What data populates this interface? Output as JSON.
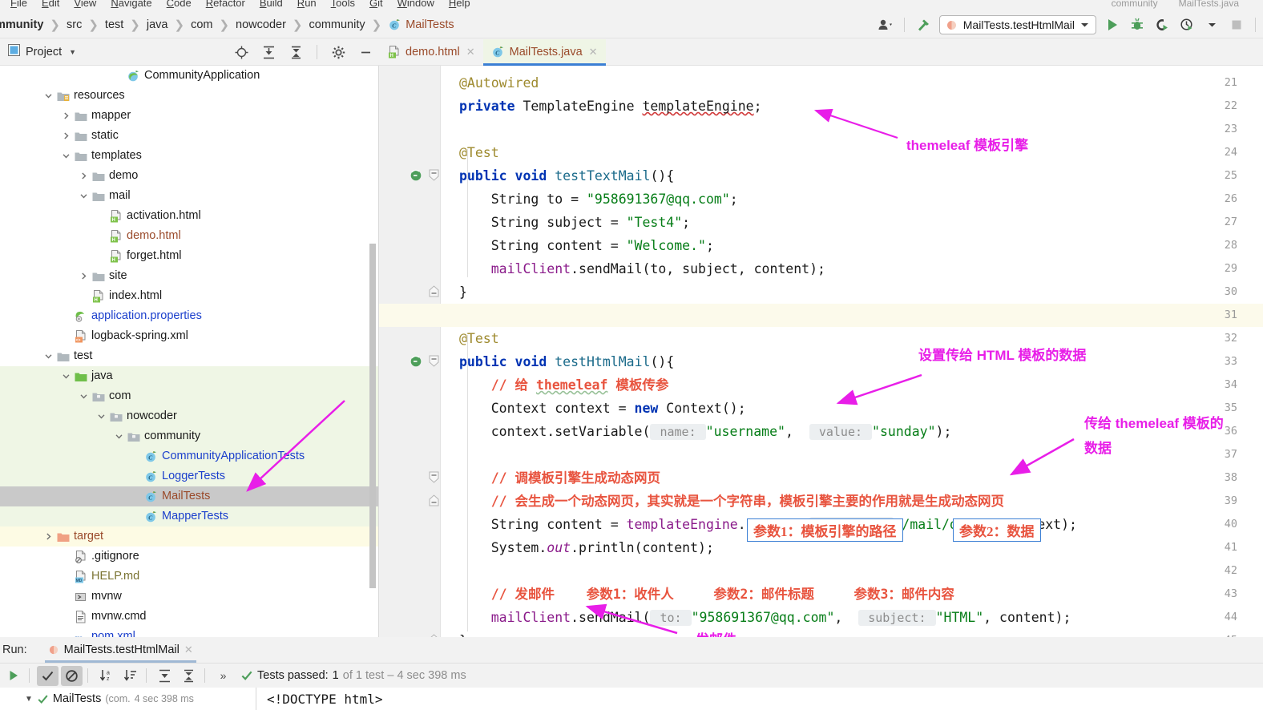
{
  "menu": {
    "items": [
      "File",
      "Edit",
      "View",
      "Navigate",
      "Code",
      "Refactor",
      "Build",
      "Run",
      "Tools",
      "Git",
      "Window",
      "Help"
    ],
    "right_hints": [
      "community",
      "MailTests.java"
    ]
  },
  "navbar": {
    "breadcrumbs": [
      {
        "label": "mmunity",
        "style": "bold"
      },
      {
        "label": "src",
        "style": "plain"
      },
      {
        "label": "test",
        "style": "plain"
      },
      {
        "label": "java",
        "style": "plain"
      },
      {
        "label": "com",
        "style": "plain"
      },
      {
        "label": "nowcoder",
        "style": "plain"
      },
      {
        "label": "community",
        "style": "plain"
      },
      {
        "label": "MailTests",
        "style": "class"
      }
    ],
    "separator": "❯",
    "run_config": "MailTests.testHtmlMail",
    "icons": [
      "user-icon",
      "hammer-icon",
      "run-icon",
      "debug-icon",
      "run-coverage-icon",
      "profile-icon",
      "stop-icon"
    ]
  },
  "project_panel": {
    "title": "Project",
    "toolbar_icons": [
      "locate-icon",
      "expand-all-icon",
      "collapse-all-icon",
      "settings-gear-icon",
      "hide-icon"
    ],
    "tree": [
      {
        "depth": 6,
        "label": "CommunityApplication",
        "icon": "spring-class-icon",
        "color": "black",
        "arrow": "",
        "bg": "white"
      },
      {
        "depth": 2,
        "label": "resources",
        "icon": "resources-folder-icon",
        "arrow": "down",
        "color": "black",
        "bg": "white"
      },
      {
        "depth": 3,
        "label": "mapper",
        "icon": "folder-icon",
        "arrow": "right",
        "color": "black",
        "bg": "white"
      },
      {
        "depth": 3,
        "label": "static",
        "icon": "folder-icon",
        "arrow": "right",
        "color": "black",
        "bg": "white"
      },
      {
        "depth": 3,
        "label": "templates",
        "icon": "folder-icon",
        "arrow": "down",
        "color": "black",
        "bg": "white"
      },
      {
        "depth": 4,
        "label": "demo",
        "icon": "folder-icon",
        "arrow": "right",
        "color": "black",
        "bg": "white"
      },
      {
        "depth": 4,
        "label": "mail",
        "icon": "folder-icon",
        "arrow": "down",
        "color": "black",
        "bg": "white"
      },
      {
        "depth": 5,
        "label": "activation.html",
        "icon": "html-file-icon",
        "arrow": "",
        "color": "black",
        "bg": "white"
      },
      {
        "depth": 5,
        "label": "demo.html",
        "icon": "html-file-icon",
        "arrow": "",
        "color": "orange",
        "bg": "white"
      },
      {
        "depth": 5,
        "label": "forget.html",
        "icon": "html-file-icon",
        "arrow": "",
        "color": "black",
        "bg": "white"
      },
      {
        "depth": 4,
        "label": "site",
        "icon": "folder-icon",
        "arrow": "right",
        "color": "black",
        "bg": "white"
      },
      {
        "depth": 4,
        "label": "index.html",
        "icon": "html-file-icon",
        "arrow": "",
        "color": "black",
        "bg": "white"
      },
      {
        "depth": 3,
        "label": "application.properties",
        "icon": "spring-properties-icon",
        "arrow": "",
        "color": "blue",
        "bg": "white"
      },
      {
        "depth": 3,
        "label": "logback-spring.xml",
        "icon": "xml-file-icon",
        "arrow": "",
        "color": "black",
        "bg": "white"
      },
      {
        "depth": 2,
        "label": "test",
        "icon": "folder-icon",
        "arrow": "down",
        "color": "black",
        "bg": "white"
      },
      {
        "depth": 3,
        "label": "java",
        "icon": "test-source-folder-icon",
        "arrow": "down",
        "color": "black",
        "bg": "green"
      },
      {
        "depth": 4,
        "label": "com",
        "icon": "package-icon",
        "arrow": "down",
        "color": "black",
        "bg": "green"
      },
      {
        "depth": 5,
        "label": "nowcoder",
        "icon": "package-icon",
        "arrow": "down",
        "color": "black",
        "bg": "green"
      },
      {
        "depth": 6,
        "label": "community",
        "icon": "package-icon",
        "arrow": "down",
        "color": "black",
        "bg": "green"
      },
      {
        "depth": 7,
        "label": "CommunityApplicationTests",
        "icon": "test-class-icon",
        "arrow": "",
        "color": "blue",
        "bg": "green"
      },
      {
        "depth": 7,
        "label": "LoggerTests",
        "icon": "test-class-icon",
        "arrow": "",
        "color": "blue",
        "bg": "green"
      },
      {
        "depth": 7,
        "label": "MailTests",
        "icon": "test-class-icon",
        "arrow": "",
        "color": "orange",
        "bg": "selected"
      },
      {
        "depth": 7,
        "label": "MapperTests",
        "icon": "test-class-icon",
        "arrow": "",
        "color": "blue",
        "bg": "green"
      },
      {
        "depth": 2,
        "label": "target",
        "icon": "excluded-folder-icon",
        "arrow": "right",
        "color": "orange",
        "bg": "yellow"
      },
      {
        "depth": 3,
        "label": ".gitignore",
        "icon": "gitignore-file-icon",
        "arrow": "",
        "color": "black",
        "bg": "white"
      },
      {
        "depth": 3,
        "label": "HELP.md",
        "icon": "markdown-file-icon",
        "arrow": "",
        "color": "olive",
        "bg": "white"
      },
      {
        "depth": 3,
        "label": "mvnw",
        "icon": "shell-file-icon",
        "arrow": "",
        "color": "black",
        "bg": "white"
      },
      {
        "depth": 3,
        "label": "mvnw.cmd",
        "icon": "text-file-icon",
        "arrow": "",
        "color": "black",
        "bg": "white"
      },
      {
        "depth": 3,
        "label": "pom.xml",
        "icon": "maven-file-icon",
        "arrow": "",
        "color": "blue",
        "bg": "white"
      }
    ]
  },
  "editor": {
    "tabs": [
      {
        "label": "demo.html",
        "icon": "html-file-icon",
        "active": false
      },
      {
        "label": "MailTests.java",
        "icon": "java-class-icon",
        "active": true
      }
    ],
    "first_line": 21,
    "highlighted_line": 31,
    "lines": [
      {
        "n": 21,
        "text": "@Autowired"
      },
      {
        "n": 22,
        "text": "private TemplateEngine templateEngine;"
      },
      {
        "n": 23,
        "text": ""
      },
      {
        "n": 24,
        "text": "@Test"
      },
      {
        "n": 25,
        "text": "public void testTextMail(){",
        "gutter": "run-test-icon",
        "fold": "fold-open"
      },
      {
        "n": 26,
        "text": "String to = \"958691367@qq.com\";"
      },
      {
        "n": 27,
        "text": "String subject = \"Test4\";"
      },
      {
        "n": 28,
        "text": "String content = \"Welcome.\";"
      },
      {
        "n": 29,
        "text": "mailClient.sendMail(to, subject, content);"
      },
      {
        "n": 30,
        "text": "}",
        "fold": "fold-close"
      },
      {
        "n": 31,
        "text": ""
      },
      {
        "n": 32,
        "text": "@Test"
      },
      {
        "n": 33,
        "text": "public void testHtmlMail(){",
        "gutter": "run-test-icon",
        "fold": "fold-open"
      },
      {
        "n": 34,
        "text": "// 给 themeleaf 模板传参"
      },
      {
        "n": 35,
        "text": "Context context = new Context();"
      },
      {
        "n": 36,
        "text": "context.setVariable( name: \"username\",  value: \"sunday\");"
      },
      {
        "n": 37,
        "text": ""
      },
      {
        "n": 38,
        "text": "// 调模板引擎生成动态网页",
        "fold": "fold-open"
      },
      {
        "n": 39,
        "text": "// 会生成一个动态网页，其实就是一个字符串，模板引擎主要的作用就是生成动态网页",
        "fold": "fold-close"
      },
      {
        "n": 40,
        "text": "String content = templateEngine.process( template: \"/mail/demo\", context);"
      },
      {
        "n": 41,
        "text": "System.out.println(content);"
      },
      {
        "n": 42,
        "text": ""
      },
      {
        "n": 43,
        "text": "// 发邮件    参数1：收件人     参数2：邮件标题     参数3：邮件内容"
      },
      {
        "n": 44,
        "text": "mailClient.sendMail( to: \"958691367@qq.com\",  subject: \"HTML\", content);"
      },
      {
        "n": 45,
        "text": "}",
        "fold": "fold-close"
      }
    ],
    "param_hints": [
      "name:",
      "value:",
      "template:",
      "to:",
      "subject:"
    ],
    "boxed_notes": [
      {
        "text": "参数1：模板引擎的路径"
      },
      {
        "text": "参数2：数据"
      }
    ]
  },
  "annotations": {
    "color": "#e81ee8",
    "notes": [
      {
        "id": "note-themeleaf-engine",
        "text": "themeleaf 模板引擎"
      },
      {
        "id": "note-set-html-data",
        "text": "设置传给 HTML 模板的数据"
      },
      {
        "id": "note-pass-to-themeleaf-1",
        "text": "传给 themeleaf 模板的"
      },
      {
        "id": "note-pass-to-themeleaf-2",
        "text": "数据"
      },
      {
        "id": "note-send-mail",
        "text": "发邮件"
      }
    ]
  },
  "run_window": {
    "label": "Run:",
    "tab": "MailTests.testHtmlMail",
    "toolbar_icons": [
      "rerun-icon",
      "show-passed-icon",
      "show-ignored-icon",
      "sort-alphabetically-icon",
      "sort-by-duration-icon",
      "expand-all-icon",
      "collapse-all-icon",
      "more-icon"
    ],
    "status_prefix": "Tests passed:",
    "status_count": "1",
    "status_suffix": "of 1 test – 4 sec 398 ms",
    "tree_root": "MailTests",
    "tree_root_pkg": "(com.",
    "tree_root_time": "4 sec 398 ms",
    "console_line": "<!DOCTYPE html>"
  }
}
